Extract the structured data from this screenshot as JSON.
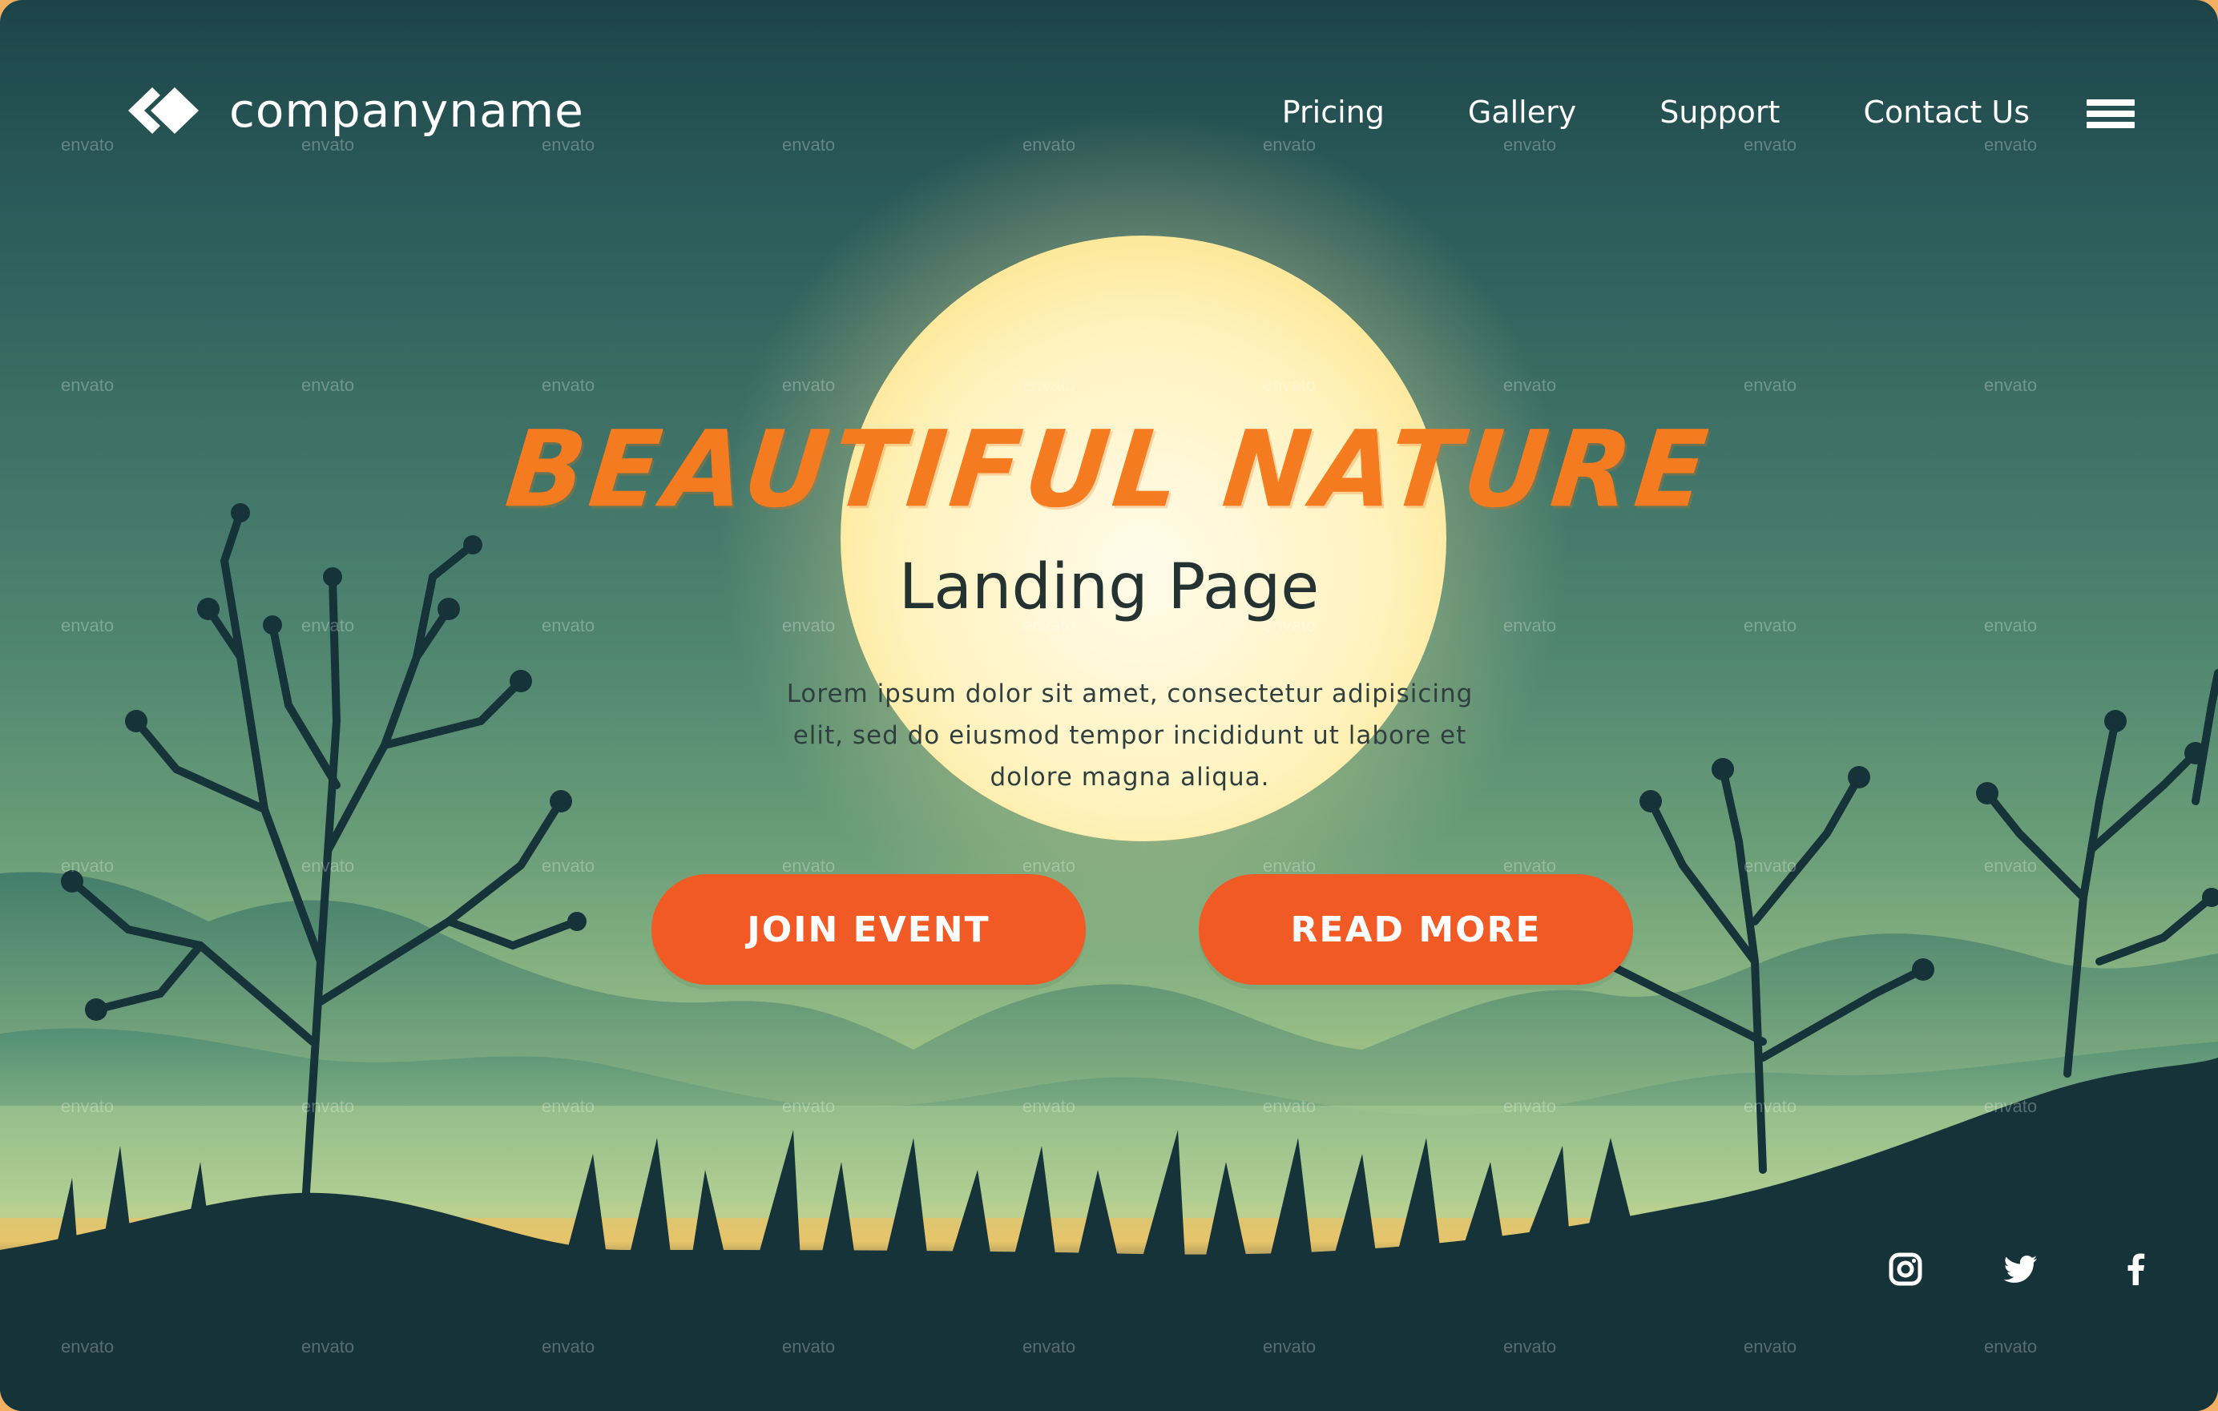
{
  "brand": {
    "name": "companyname",
    "logo_icon": "diamond-logo-icon"
  },
  "nav": {
    "items": [
      {
        "label": "Pricing"
      },
      {
        "label": "Gallery"
      },
      {
        "label": "Support"
      },
      {
        "label": "Contact Us"
      }
    ],
    "menu_icon": "hamburger-menu-icon"
  },
  "hero": {
    "title": "BEAUTIFUL NATURE",
    "subtitle": "Landing Page",
    "description": "Lorem ipsum dolor sit amet, consectetur adipisicing elit, sed do eiusmod tempor incididunt ut labore et dolore magna aliqua."
  },
  "buttons": {
    "join": "JOIN EVENT",
    "read": "READ MORE"
  },
  "social": [
    "instagram-icon",
    "twitter-icon",
    "facebook-icon"
  ],
  "watermark": "envato",
  "colors": {
    "accent": "#f15a24",
    "title": "#f47b20",
    "dark_ground": "#17333a",
    "moon": "#fff3c2"
  }
}
